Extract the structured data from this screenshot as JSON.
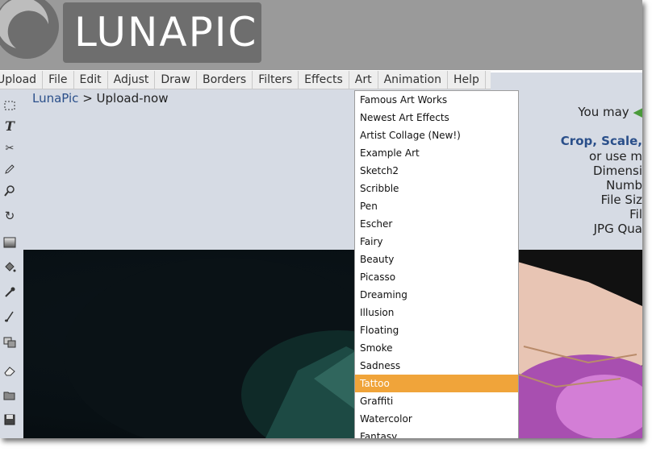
{
  "brand": {
    "logo_text": "LUNAPIC"
  },
  "menu": [
    "Upload",
    "File",
    "Edit",
    "Adjust",
    "Draw",
    "Borders",
    "Filters",
    "Effects",
    "Art",
    "Animation",
    "Help"
  ],
  "breadcrumb": {
    "home": "LunaPic",
    "separator": " > ",
    "current": "Upload-now"
  },
  "art_menu": {
    "items": [
      "Famous Art Works",
      "Newest Art Effects",
      "Artist Collage (New!)",
      "Example Art",
      "Sketch2",
      "Scribble",
      "Pen",
      "Escher",
      "Fairy",
      "Beauty",
      "Picasso",
      "Dreaming",
      "Illusion",
      "Floating",
      "Smoke",
      "Sadness",
      "Tattoo",
      "Graffiti",
      "Watercolor",
      "Fantasy"
    ],
    "highlighted": "Tattoo"
  },
  "right_panel": {
    "you_may": "You may",
    "crop_scale": "Crop, Scale,",
    "or_use": "or use m",
    "dimension": "Dimensi",
    "number": "Numb",
    "file_size": "File Siz",
    "file": "Fil",
    "jpg_quality": "JPG Qua"
  },
  "colors": {
    "accent": "#f0a43a",
    "link": "#2a4f8a",
    "header_bg": "#9a9a9a",
    "menubar_bg": "#eeeeee"
  },
  "toolbar_icons": [
    "marquee-select-icon",
    "text-icon",
    "scissors-icon",
    "pencil-icon",
    "zoom-icon",
    "rotate-icon",
    "gradient-icon",
    "paint-bucket-icon",
    "eyedropper-icon",
    "brush-icon",
    "clone-icon",
    "eraser-icon",
    "open-folder-icon",
    "save-icon"
  ]
}
